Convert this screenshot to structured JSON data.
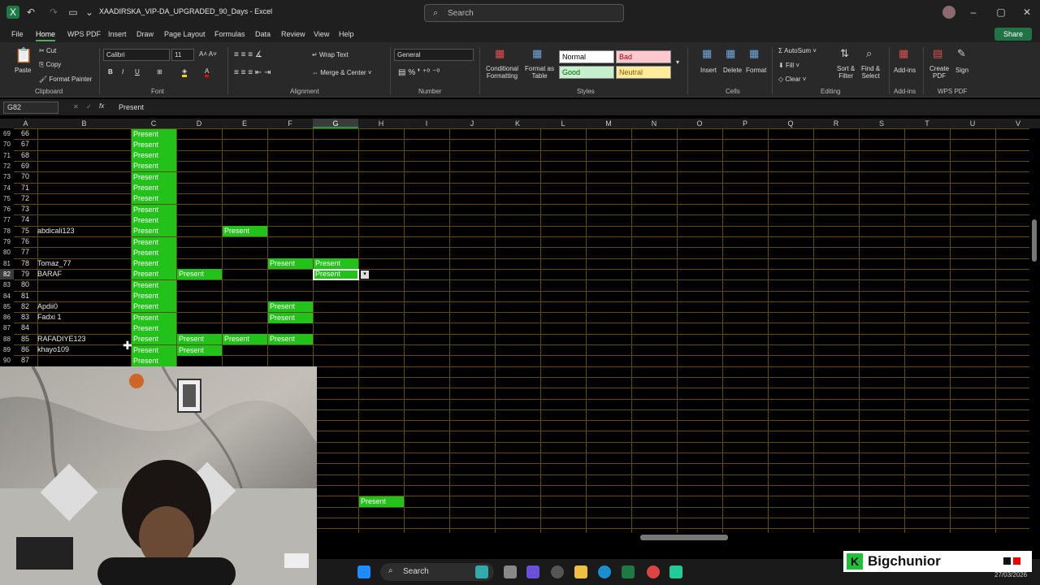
{
  "window": {
    "title": "XAADIRSKA_VIP-DA_UPGRADED_90_Days  -  Excel",
    "search_placeholder": "Search"
  },
  "menu": [
    "File",
    "Home",
    "WPS PDF",
    "Insert",
    "Draw",
    "Page Layout",
    "Formulas",
    "Data",
    "Review",
    "View",
    "Help"
  ],
  "share_label": "Share",
  "ribbon": {
    "clipboard": {
      "paste": "Paste",
      "cut": "Cut",
      "copy": "Copy",
      "format_painter": "Format Painter",
      "group": "Clipboard"
    },
    "font": {
      "name": "Calibri",
      "size": "11",
      "group": "Font"
    },
    "alignment": {
      "wrap": "Wrap Text",
      "merge": "Merge & Center",
      "group": "Alignment"
    },
    "number": {
      "format": "General",
      "group": "Number"
    },
    "styles": {
      "conditional": "Conditional",
      "conditional2": "Formatting",
      "format_as": "Format as",
      "format_as2": "Table",
      "normal": "Normal",
      "bad": "Bad",
      "good": "Good",
      "neutral": "Neutral",
      "group": "Styles"
    },
    "cells": {
      "insert": "Insert",
      "delete": "Delete",
      "format": "Format",
      "group": "Cells"
    },
    "editing": {
      "autosum": "AutoSum",
      "fill": "Fill",
      "clear": "Clear",
      "sort": "Sort &",
      "sort2": "Filter",
      "find": "Find &",
      "find2": "Select",
      "group": "Editing"
    },
    "addins": {
      "label": "Add-ins",
      "group": "Add-ins"
    },
    "wps": {
      "create": "Create",
      "create2": "PDF",
      "sign": "Sign",
      "group": "WPS PDF"
    }
  },
  "formula_bar": {
    "name_box": "G82",
    "value": "Present"
  },
  "columns": [
    "A",
    "B",
    "C",
    "D",
    "E",
    "F",
    "G",
    "H",
    "I",
    "J",
    "K",
    "L",
    "M",
    "N",
    "O",
    "P",
    "Q",
    "R",
    "S",
    "T",
    "U",
    "V"
  ],
  "rows": [
    {
      "r": "69",
      "n": "66",
      "name": "",
      "marks": [
        "C"
      ]
    },
    {
      "r": "70",
      "n": "67",
      "name": "",
      "marks": [
        "C"
      ]
    },
    {
      "r": "71",
      "n": "68",
      "name": "",
      "marks": [
        "C"
      ]
    },
    {
      "r": "72",
      "n": "69",
      "name": "",
      "marks": [
        "C"
      ]
    },
    {
      "r": "73",
      "n": "70",
      "name": "",
      "marks": [
        "C"
      ]
    },
    {
      "r": "74",
      "n": "71",
      "name": "",
      "marks": [
        "C"
      ]
    },
    {
      "r": "75",
      "n": "72",
      "name": "",
      "marks": [
        "C"
      ]
    },
    {
      "r": "76",
      "n": "73",
      "name": "",
      "marks": [
        "C"
      ]
    },
    {
      "r": "77",
      "n": "74",
      "name": "",
      "marks": [
        "C"
      ]
    },
    {
      "r": "78",
      "n": "75",
      "name": "abdicali123",
      "marks": [
        "C",
        "E"
      ]
    },
    {
      "r": "79",
      "n": "76",
      "name": "",
      "marks": [
        "C"
      ]
    },
    {
      "r": "80",
      "n": "77",
      "name": "",
      "marks": [
        "C"
      ]
    },
    {
      "r": "81",
      "n": "78",
      "name": "Tomaz_77",
      "marks": [
        "C",
        "F",
        "G"
      ]
    },
    {
      "r": "82",
      "n": "79",
      "name": "BARAF",
      "marks": [
        "C",
        "D",
        "G"
      ]
    },
    {
      "r": "83",
      "n": "80",
      "name": "",
      "marks": [
        "C"
      ]
    },
    {
      "r": "84",
      "n": "81",
      "name": "",
      "marks": [
        "C"
      ]
    },
    {
      "r": "85",
      "n": "82",
      "name": "Apdii0",
      "marks": [
        "C",
        "F"
      ]
    },
    {
      "r": "86",
      "n": "83",
      "name": "Fadxi 1",
      "marks": [
        "C",
        "F"
      ]
    },
    {
      "r": "87",
      "n": "84",
      "name": "",
      "marks": [
        "C"
      ]
    },
    {
      "r": "88",
      "n": "85",
      "name": "RAFADIYE123",
      "marks": [
        "C",
        "D",
        "E",
        "F"
      ]
    },
    {
      "r": "89",
      "n": "86",
      "name": "khayo109",
      "marks": [
        "C",
        "D"
      ]
    },
    {
      "r": "90",
      "n": "87",
      "name": "",
      "marks": [
        "C"
      ]
    }
  ],
  "present_label": "Present",
  "stray_present": "Present",
  "taskbar": {
    "search": "Search",
    "date": "27/03/2026"
  },
  "streamer": "Bigchunior"
}
